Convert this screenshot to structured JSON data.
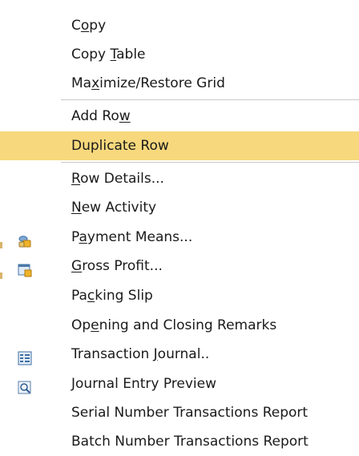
{
  "menu": {
    "items": [
      {
        "pre": "C",
        "ul": "o",
        "post": "py"
      },
      {
        "pre": "Copy ",
        "ul": "T",
        "post": "able"
      },
      {
        "pre": "Ma",
        "ul": "x",
        "post": "imize/Restore Grid"
      },
      {
        "pre": "Add Ro",
        "ul": "w",
        "post": ""
      },
      {
        "pre": "Duplicate Row",
        "ul": "",
        "post": ""
      },
      {
        "pre": "",
        "ul": "R",
        "post": "ow Details..."
      },
      {
        "pre": "",
        "ul": "N",
        "post": "ew Activity"
      },
      {
        "pre": "P",
        "ul": "a",
        "post": "yment Means..."
      },
      {
        "pre": "",
        "ul": "G",
        "post": "ross Profit..."
      },
      {
        "pre": "Pa",
        "ul": "c",
        "post": "king Slip"
      },
      {
        "pre": "Op",
        "ul": "e",
        "post": "ning and Closing Remarks"
      },
      {
        "pre": "Transaction ",
        "ul": "J",
        "post": "ournal.."
      },
      {
        "pre": "Journal Entry Preview",
        "ul": "",
        "post": ""
      },
      {
        "pre": "Serial Number Transactions Report",
        "ul": "",
        "post": ""
      },
      {
        "pre": "Batch Number Transactions Report",
        "ul": "",
        "post": ""
      }
    ],
    "icons": {
      "payment": "payment-means-icon",
      "gross": "gross-profit-icon",
      "journal": "transaction-journal-icon",
      "preview": "journal-entry-preview-icon"
    },
    "colors": {
      "highlight": "#f7d87d",
      "separator": "#c9c9c9"
    }
  }
}
